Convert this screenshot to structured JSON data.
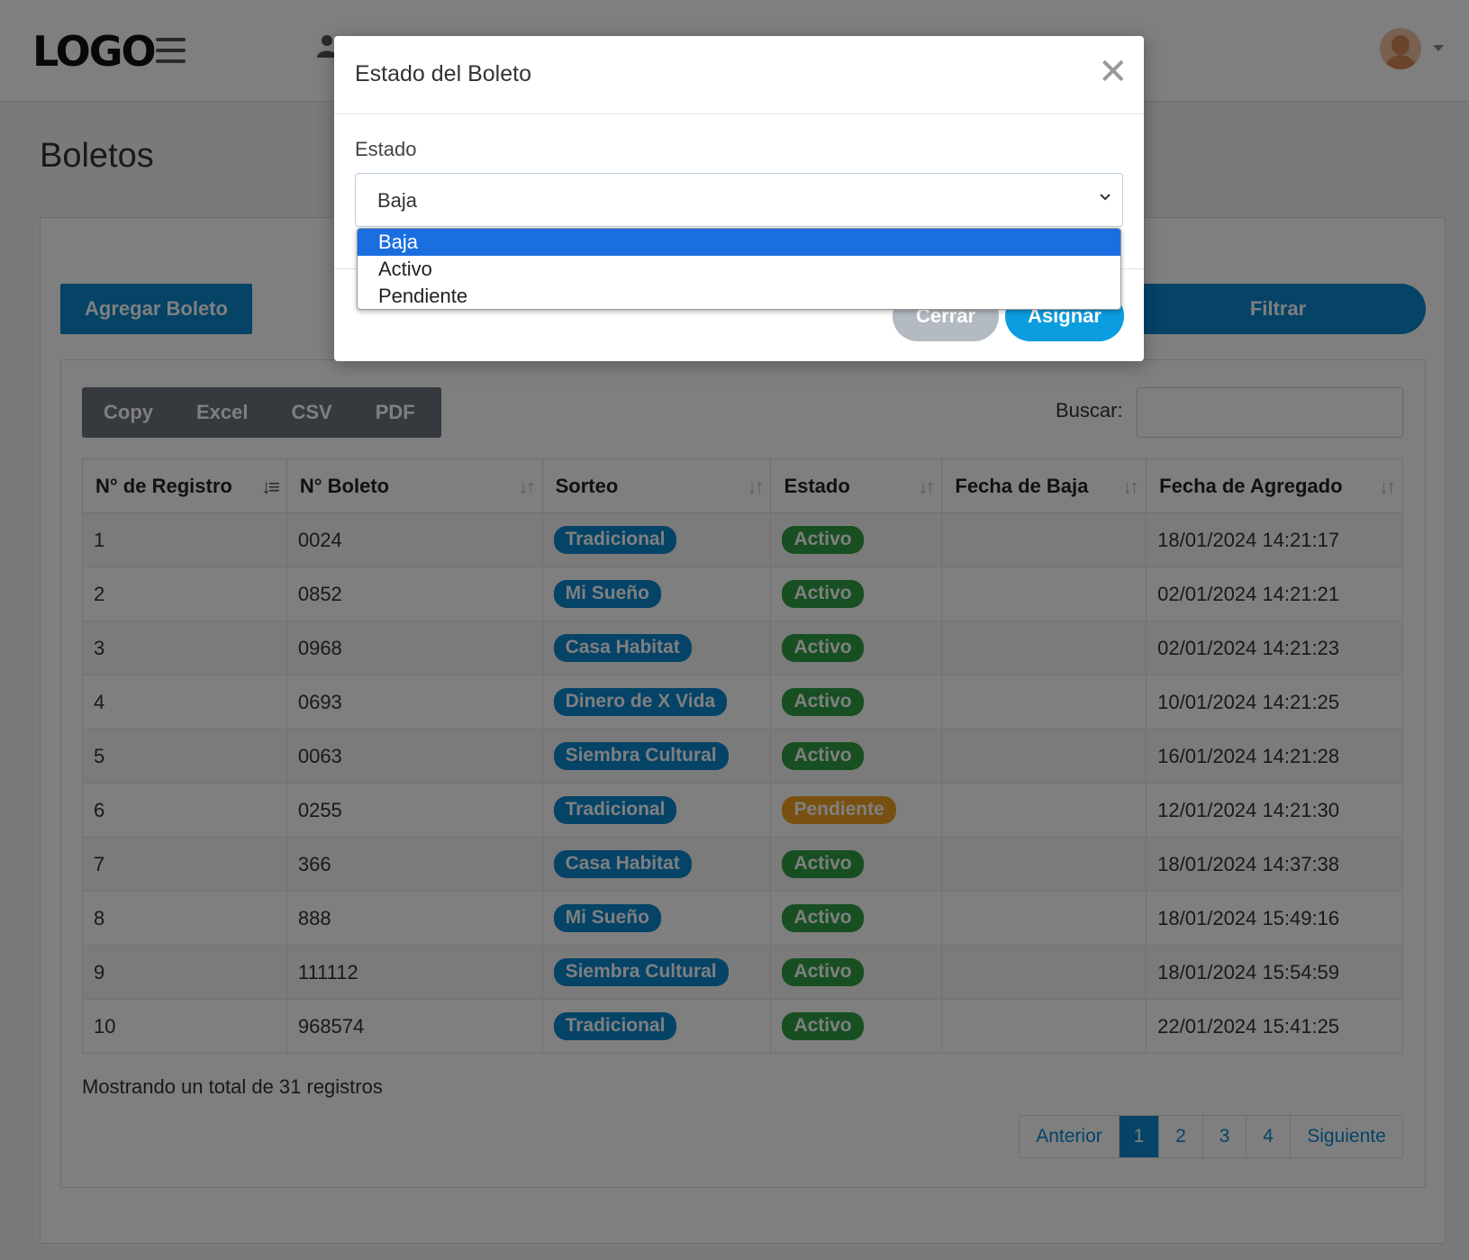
{
  "header": {
    "logo": "LOGO"
  },
  "page": {
    "title": "Boletos"
  },
  "toolbar": {
    "add_label": "Agregar Boleto",
    "filter_label": "Filtrar"
  },
  "export": {
    "buttons": [
      "Copy",
      "Excel",
      "CSV",
      "PDF"
    ]
  },
  "search": {
    "label": "Buscar:",
    "placeholder": ""
  },
  "table": {
    "columns": [
      "N° de Registro",
      "N° Boleto",
      "Sorteo",
      "Estado",
      "Fecha de Baja",
      "Fecha de Agregado"
    ],
    "rows": [
      {
        "registro": "1",
        "boleto": "0024",
        "sorteo": "Tradicional",
        "estado": "Activo",
        "fecha_baja": "",
        "fecha_agregado": "18/01/2024 14:21:17"
      },
      {
        "registro": "2",
        "boleto": "0852",
        "sorteo": "Mi Sueño",
        "estado": "Activo",
        "fecha_baja": "",
        "fecha_agregado": "02/01/2024 14:21:21"
      },
      {
        "registro": "3",
        "boleto": "0968",
        "sorteo": "Casa Habitat",
        "estado": "Activo",
        "fecha_baja": "",
        "fecha_agregado": "02/01/2024 14:21:23"
      },
      {
        "registro": "4",
        "boleto": "0693",
        "sorteo": "Dinero de X Vida",
        "estado": "Activo",
        "fecha_baja": "",
        "fecha_agregado": "10/01/2024 14:21:25"
      },
      {
        "registro": "5",
        "boleto": "0063",
        "sorteo": "Siembra Cultural",
        "estado": "Activo",
        "fecha_baja": "",
        "fecha_agregado": "16/01/2024 14:21:28"
      },
      {
        "registro": "6",
        "boleto": "0255",
        "sorteo": "Tradicional",
        "estado": "Pendiente",
        "fecha_baja": "",
        "fecha_agregado": "12/01/2024 14:21:30"
      },
      {
        "registro": "7",
        "boleto": "366",
        "sorteo": "Casa Habitat",
        "estado": "Activo",
        "fecha_baja": "",
        "fecha_agregado": "18/01/2024 14:37:38"
      },
      {
        "registro": "8",
        "boleto": "888",
        "sorteo": "Mi Sueño",
        "estado": "Activo",
        "fecha_baja": "",
        "fecha_agregado": "18/01/2024 15:49:16"
      },
      {
        "registro": "9",
        "boleto": "111112",
        "sorteo": "Siembra Cultural",
        "estado": "Activo",
        "fecha_baja": "",
        "fecha_agregado": "18/01/2024 15:54:59"
      },
      {
        "registro": "10",
        "boleto": "968574",
        "sorteo": "Tradicional",
        "estado": "Activo",
        "fecha_baja": "",
        "fecha_agregado": "22/01/2024 15:41:25"
      }
    ]
  },
  "summary": "Mostrando un total de 31 registros",
  "pagination": {
    "prev": "Anterior",
    "pages": [
      "1",
      "2",
      "3",
      "4"
    ],
    "current": "1",
    "next": "Siguiente"
  },
  "modal": {
    "title": "Estado del Boleto",
    "close_symbol": "✕",
    "field_label": "Estado",
    "selected": "Baja",
    "options": [
      "Baja",
      "Activo",
      "Pendiente"
    ],
    "cancel_label": "Cerrar",
    "assign_label": "Asignar"
  },
  "colors": {
    "primary": "#0a86cf",
    "success": "#2e9e44",
    "warning": "#f0a020",
    "secondary": "#6c757d",
    "option_highlight": "#1a6ee0"
  }
}
